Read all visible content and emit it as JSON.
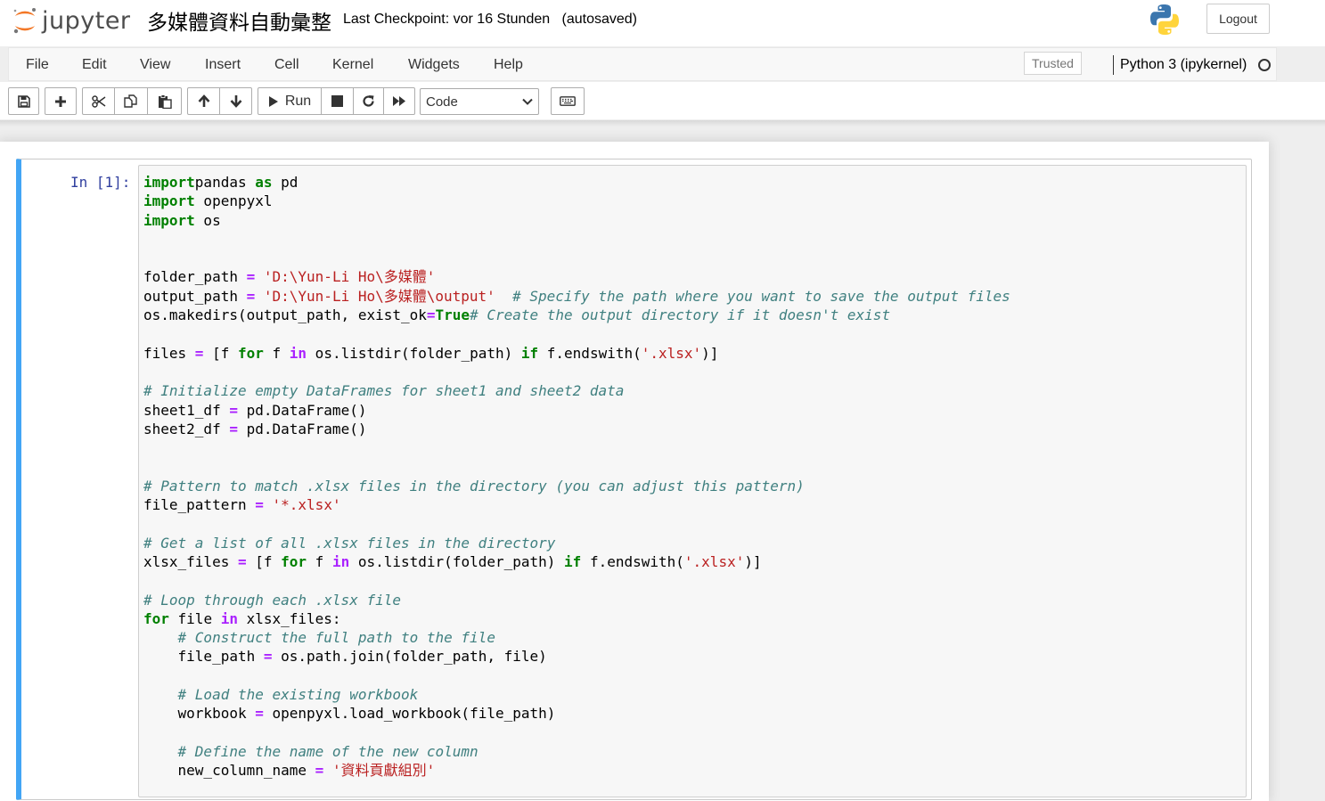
{
  "header": {
    "logo_text": "jupyter",
    "notebook_title": "多媒體資料自動彙整",
    "checkpoint": "Last Checkpoint: vor 16 Stunden",
    "autosave": "(autosaved)",
    "logout_label": "Logout"
  },
  "menubar": {
    "items": [
      "File",
      "Edit",
      "View",
      "Insert",
      "Cell",
      "Kernel",
      "Widgets",
      "Help"
    ],
    "trusted_label": "Trusted",
    "kernel_name": "Python 3 (ipykernel)"
  },
  "toolbar": {
    "buttons": [
      "save-icon",
      "plus-icon",
      "cut-icon",
      "copy-icon",
      "paste-icon",
      "arrow-up-icon",
      "arrow-down-icon",
      "play-icon",
      "stop-icon",
      "restart-icon",
      "fast-forward-icon",
      "keyboard-icon"
    ],
    "run_label": "Run",
    "cell_type": "Code"
  },
  "cell": {
    "prompt": "In [1]:",
    "lines": [
      [
        [
          "kw",
          "import"
        ],
        [
          "",
          "pandas "
        ],
        [
          "kw",
          "as"
        ],
        [
          "",
          " pd"
        ]
      ],
      [
        [
          "kw",
          "import"
        ],
        [
          "",
          " openpyxl"
        ]
      ],
      [
        [
          "kw",
          "import"
        ],
        [
          "",
          " os"
        ]
      ],
      [],
      [],
      [
        [
          "",
          "folder_path "
        ],
        [
          "op",
          "="
        ],
        [
          "",
          " "
        ],
        [
          "st",
          "'D:\\Yun-Li Ho\\多媒體'"
        ]
      ],
      [
        [
          "",
          "output_path "
        ],
        [
          "op",
          "="
        ],
        [
          "",
          " "
        ],
        [
          "st",
          "'D:\\Yun-Li Ho\\多媒體\\output'"
        ],
        [
          "",
          "  "
        ],
        [
          "cm",
          "# Specify the path where you want to save the output files"
        ]
      ],
      [
        [
          "",
          "os.makedirs(output_path, exist_ok"
        ],
        [
          "op",
          "="
        ],
        [
          "kw",
          "True"
        ],
        [
          ")  "
        ],
        [
          "cm",
          "# Create the output directory if it doesn't exist"
        ]
      ],
      [],
      [
        [
          "",
          "files "
        ],
        [
          "op",
          "="
        ],
        [
          "",
          " [f "
        ],
        [
          "kw",
          "for"
        ],
        [
          "",
          " f "
        ],
        [
          "op",
          "in"
        ],
        [
          "",
          " os.listdir(folder_path) "
        ],
        [
          "kw",
          "if"
        ],
        [
          "",
          " f.endswith("
        ],
        [
          "st",
          "'.xlsx'"
        ],
        [
          "",
          ")]"
        ]
      ],
      [],
      [
        [
          "cm",
          "# Initialize empty DataFrames for sheet1 and sheet2 data"
        ]
      ],
      [
        [
          "",
          "sheet1_df "
        ],
        [
          "op",
          "="
        ],
        [
          "",
          " pd.DataFrame()"
        ]
      ],
      [
        [
          "",
          "sheet2_df "
        ],
        [
          "op",
          "="
        ],
        [
          "",
          " pd.DataFrame()"
        ]
      ],
      [],
      [],
      [
        [
          "cm",
          "# Pattern to match .xlsx files in the directory (you can adjust this pattern)"
        ]
      ],
      [
        [
          "",
          "file_pattern "
        ],
        [
          "op",
          "="
        ],
        [
          "",
          " "
        ],
        [
          "st",
          "'*.xlsx'"
        ]
      ],
      [],
      [
        [
          "cm",
          "# Get a list of all .xlsx files in the directory"
        ]
      ],
      [
        [
          "",
          "xlsx_files "
        ],
        [
          "op",
          "="
        ],
        [
          "",
          " [f "
        ],
        [
          "kw",
          "for"
        ],
        [
          "",
          " f "
        ],
        [
          "op",
          "in"
        ],
        [
          "",
          " os.listdir(folder_path) "
        ],
        [
          "kw",
          "if"
        ],
        [
          "",
          " f.endswith("
        ],
        [
          "st",
          "'.xlsx'"
        ],
        [
          "",
          ")]"
        ]
      ],
      [],
      [
        [
          "cm",
          "# Loop through each .xlsx file"
        ]
      ],
      [
        [
          "kw",
          "for"
        ],
        [
          "",
          " file "
        ],
        [
          "op",
          "in"
        ],
        [
          "",
          " xlsx_files:"
        ]
      ],
      [
        [
          "",
          "    "
        ],
        [
          "cm",
          "# Construct the full path to the file"
        ]
      ],
      [
        [
          "",
          "    file_path "
        ],
        [
          "op",
          "="
        ],
        [
          "",
          " os.path.join(folder_path, file)"
        ]
      ],
      [],
      [
        [
          "",
          "    "
        ],
        [
          "cm",
          "# Load the existing workbook"
        ]
      ],
      [
        [
          "",
          "    workbook "
        ],
        [
          "op",
          "="
        ],
        [
          "",
          " openpyxl.load_workbook(file_path)"
        ]
      ],
      [],
      [
        [
          "",
          "    "
        ],
        [
          "cm",
          "# Define the name of the new column"
        ]
      ],
      [
        [
          "",
          "    new_column_name "
        ],
        [
          "op",
          "="
        ],
        [
          "",
          " "
        ],
        [
          "st",
          "'資料貢獻組別'"
        ]
      ]
    ]
  }
}
